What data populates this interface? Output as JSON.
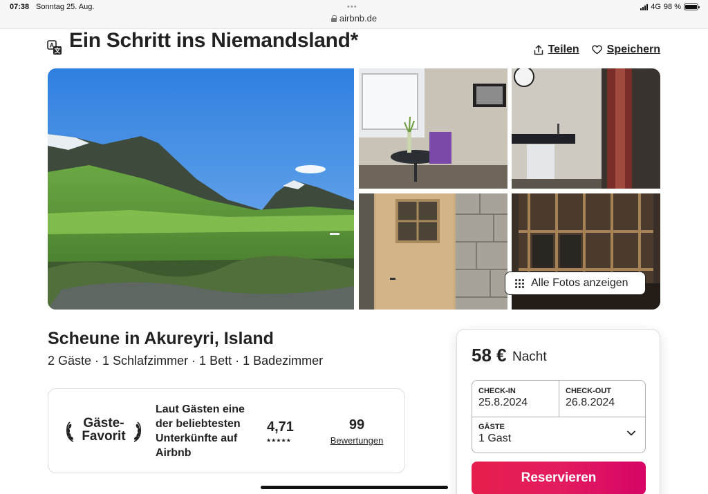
{
  "status_bar": {
    "time": "07:38",
    "date": "Sonntag 25. Aug.",
    "url": "airbnb.de",
    "network": "4G",
    "battery": "98 %",
    "battery_level": 0.98
  },
  "listing": {
    "title": "Ein Schritt ins Niemandsland*",
    "share_label": "Teilen",
    "save_label": "Speichern",
    "show_all_photos_label": "Alle Fotos anzeigen",
    "subtitle": "Scheune in Akureyri, Island",
    "details": "2 Gäste · 1 Schlafzimmer · 1 Bett · 1 Badezimmer"
  },
  "guest_favorite": {
    "label_line1": "Gäste-",
    "label_line2": "Favorit",
    "description": "Laut Gästen eine der beliebtesten Unterkünfte auf Airbnb",
    "rating": "4,71",
    "stars": "★★★★★",
    "reviews_count": "99",
    "reviews_label": "Bewertungen"
  },
  "booking": {
    "price": "58 €",
    "price_unit": "Nacht",
    "checkin_label": "CHECK-IN",
    "checkin_value": "25.8.2024",
    "checkout_label": "CHECK-OUT",
    "checkout_value": "26.8.2024",
    "guests_label": "GÄSTE",
    "guests_value": "1 Gast",
    "reserve_label": "Reservieren",
    "accent_color": "#e31c5f"
  },
  "icons": [
    "translate-icon",
    "share-icon",
    "heart-icon",
    "grid-dots-icon",
    "laurel-icon",
    "chevron-down-icon",
    "lock-icon"
  ]
}
